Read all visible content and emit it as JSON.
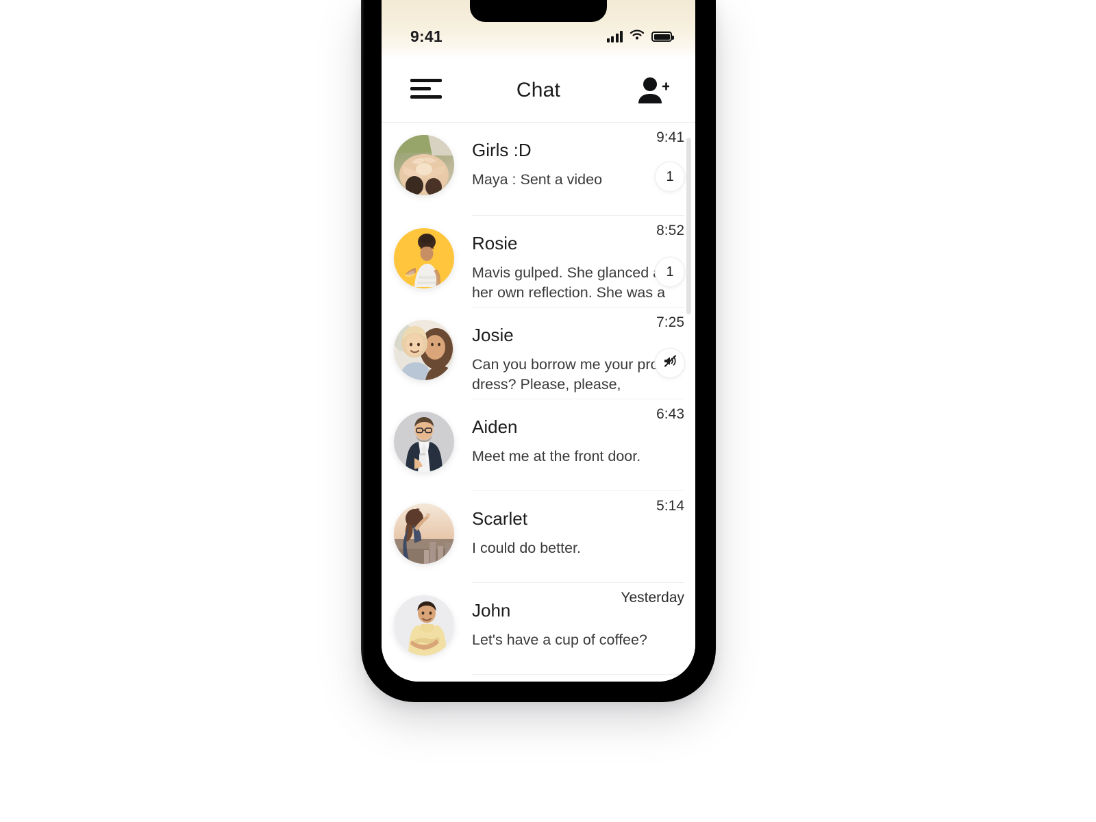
{
  "status_bar": {
    "time": "9:41",
    "signal_icon": "cellular-signal-icon",
    "wifi_icon": "wifi-icon",
    "battery_icon": "battery-full-icon"
  },
  "nav": {
    "menu_icon": "hamburger-menu-icon",
    "title": "Chat",
    "add_contact_icon": "add-person-icon"
  },
  "colors": {
    "accent_yellow": "#FFC53D",
    "status_bar_cream": "#F4EBD5",
    "text_primary": "#1C1C1E",
    "text_secondary": "#3A3A3C",
    "divider": "#EEEEEE",
    "frame_black": "#000000"
  },
  "chats": [
    {
      "name": "Girls :D",
      "message": "Maya : Sent a video",
      "time": "9:41",
      "badge": "1",
      "badge_type": "unread-count",
      "avatar": "group-hands-photo"
    },
    {
      "name": "Rosie",
      "message": "Mavis gulped. She glanced at her own reflection. She was a loving, caring,",
      "time": "8:52",
      "badge": "1",
      "badge_type": "unread-count",
      "avatar": "woman-yellow-background-photo"
    },
    {
      "name": "Josie",
      "message": "Can you borrow me your prom dress? Please, please, pleaaaaassseeee!!",
      "time": "7:25",
      "badge": "",
      "badge_type": "muted",
      "avatar": "two-girls-selfie-photo"
    },
    {
      "name": "Aiden",
      "message": "Meet me at the front door.",
      "time": "6:43",
      "badge": "",
      "badge_type": "none",
      "avatar": "man-glasses-blazer-photo"
    },
    {
      "name": "Scarlet",
      "message": "I could do better.",
      "time": "5:14",
      "badge": "",
      "badge_type": "none",
      "avatar": "woman-sunset-city-photo"
    },
    {
      "name": "John",
      "message": "Let's have a cup of coffee?",
      "time": "Yesterday",
      "badge": "",
      "badge_type": "none",
      "avatar": "man-yellow-shirt-photo"
    }
  ],
  "scrollbar": {
    "position_label": "top"
  }
}
